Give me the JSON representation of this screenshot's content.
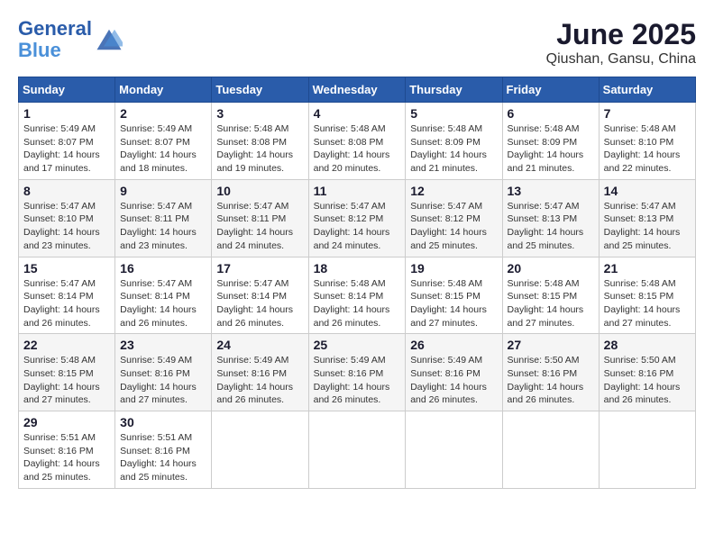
{
  "header": {
    "logo_line1": "General",
    "logo_line2": "Blue",
    "month_title": "June 2025",
    "location": "Qiushan, Gansu, China"
  },
  "weekdays": [
    "Sunday",
    "Monday",
    "Tuesday",
    "Wednesday",
    "Thursday",
    "Friday",
    "Saturday"
  ],
  "weeks": [
    [
      {
        "day": 1,
        "info": "Sunrise: 5:49 AM\nSunset: 8:07 PM\nDaylight: 14 hours\nand 17 minutes."
      },
      {
        "day": 2,
        "info": "Sunrise: 5:49 AM\nSunset: 8:07 PM\nDaylight: 14 hours\nand 18 minutes."
      },
      {
        "day": 3,
        "info": "Sunrise: 5:48 AM\nSunset: 8:08 PM\nDaylight: 14 hours\nand 19 minutes."
      },
      {
        "day": 4,
        "info": "Sunrise: 5:48 AM\nSunset: 8:08 PM\nDaylight: 14 hours\nand 20 minutes."
      },
      {
        "day": 5,
        "info": "Sunrise: 5:48 AM\nSunset: 8:09 PM\nDaylight: 14 hours\nand 21 minutes."
      },
      {
        "day": 6,
        "info": "Sunrise: 5:48 AM\nSunset: 8:09 PM\nDaylight: 14 hours\nand 21 minutes."
      },
      {
        "day": 7,
        "info": "Sunrise: 5:48 AM\nSunset: 8:10 PM\nDaylight: 14 hours\nand 22 minutes."
      }
    ],
    [
      {
        "day": 8,
        "info": "Sunrise: 5:47 AM\nSunset: 8:10 PM\nDaylight: 14 hours\nand 23 minutes."
      },
      {
        "day": 9,
        "info": "Sunrise: 5:47 AM\nSunset: 8:11 PM\nDaylight: 14 hours\nand 23 minutes."
      },
      {
        "day": 10,
        "info": "Sunrise: 5:47 AM\nSunset: 8:11 PM\nDaylight: 14 hours\nand 24 minutes."
      },
      {
        "day": 11,
        "info": "Sunrise: 5:47 AM\nSunset: 8:12 PM\nDaylight: 14 hours\nand 24 minutes."
      },
      {
        "day": 12,
        "info": "Sunrise: 5:47 AM\nSunset: 8:12 PM\nDaylight: 14 hours\nand 25 minutes."
      },
      {
        "day": 13,
        "info": "Sunrise: 5:47 AM\nSunset: 8:13 PM\nDaylight: 14 hours\nand 25 minutes."
      },
      {
        "day": 14,
        "info": "Sunrise: 5:47 AM\nSunset: 8:13 PM\nDaylight: 14 hours\nand 25 minutes."
      }
    ],
    [
      {
        "day": 15,
        "info": "Sunrise: 5:47 AM\nSunset: 8:14 PM\nDaylight: 14 hours\nand 26 minutes."
      },
      {
        "day": 16,
        "info": "Sunrise: 5:47 AM\nSunset: 8:14 PM\nDaylight: 14 hours\nand 26 minutes."
      },
      {
        "day": 17,
        "info": "Sunrise: 5:47 AM\nSunset: 8:14 PM\nDaylight: 14 hours\nand 26 minutes."
      },
      {
        "day": 18,
        "info": "Sunrise: 5:48 AM\nSunset: 8:14 PM\nDaylight: 14 hours\nand 26 minutes."
      },
      {
        "day": 19,
        "info": "Sunrise: 5:48 AM\nSunset: 8:15 PM\nDaylight: 14 hours\nand 27 minutes."
      },
      {
        "day": 20,
        "info": "Sunrise: 5:48 AM\nSunset: 8:15 PM\nDaylight: 14 hours\nand 27 minutes."
      },
      {
        "day": 21,
        "info": "Sunrise: 5:48 AM\nSunset: 8:15 PM\nDaylight: 14 hours\nand 27 minutes."
      }
    ],
    [
      {
        "day": 22,
        "info": "Sunrise: 5:48 AM\nSunset: 8:15 PM\nDaylight: 14 hours\nand 27 minutes."
      },
      {
        "day": 23,
        "info": "Sunrise: 5:49 AM\nSunset: 8:16 PM\nDaylight: 14 hours\nand 27 minutes."
      },
      {
        "day": 24,
        "info": "Sunrise: 5:49 AM\nSunset: 8:16 PM\nDaylight: 14 hours\nand 26 minutes."
      },
      {
        "day": 25,
        "info": "Sunrise: 5:49 AM\nSunset: 8:16 PM\nDaylight: 14 hours\nand 26 minutes."
      },
      {
        "day": 26,
        "info": "Sunrise: 5:49 AM\nSunset: 8:16 PM\nDaylight: 14 hours\nand 26 minutes."
      },
      {
        "day": 27,
        "info": "Sunrise: 5:50 AM\nSunset: 8:16 PM\nDaylight: 14 hours\nand 26 minutes."
      },
      {
        "day": 28,
        "info": "Sunrise: 5:50 AM\nSunset: 8:16 PM\nDaylight: 14 hours\nand 26 minutes."
      }
    ],
    [
      {
        "day": 29,
        "info": "Sunrise: 5:51 AM\nSunset: 8:16 PM\nDaylight: 14 hours\nand 25 minutes."
      },
      {
        "day": 30,
        "info": "Sunrise: 5:51 AM\nSunset: 8:16 PM\nDaylight: 14 hours\nand 25 minutes."
      },
      null,
      null,
      null,
      null,
      null
    ]
  ]
}
